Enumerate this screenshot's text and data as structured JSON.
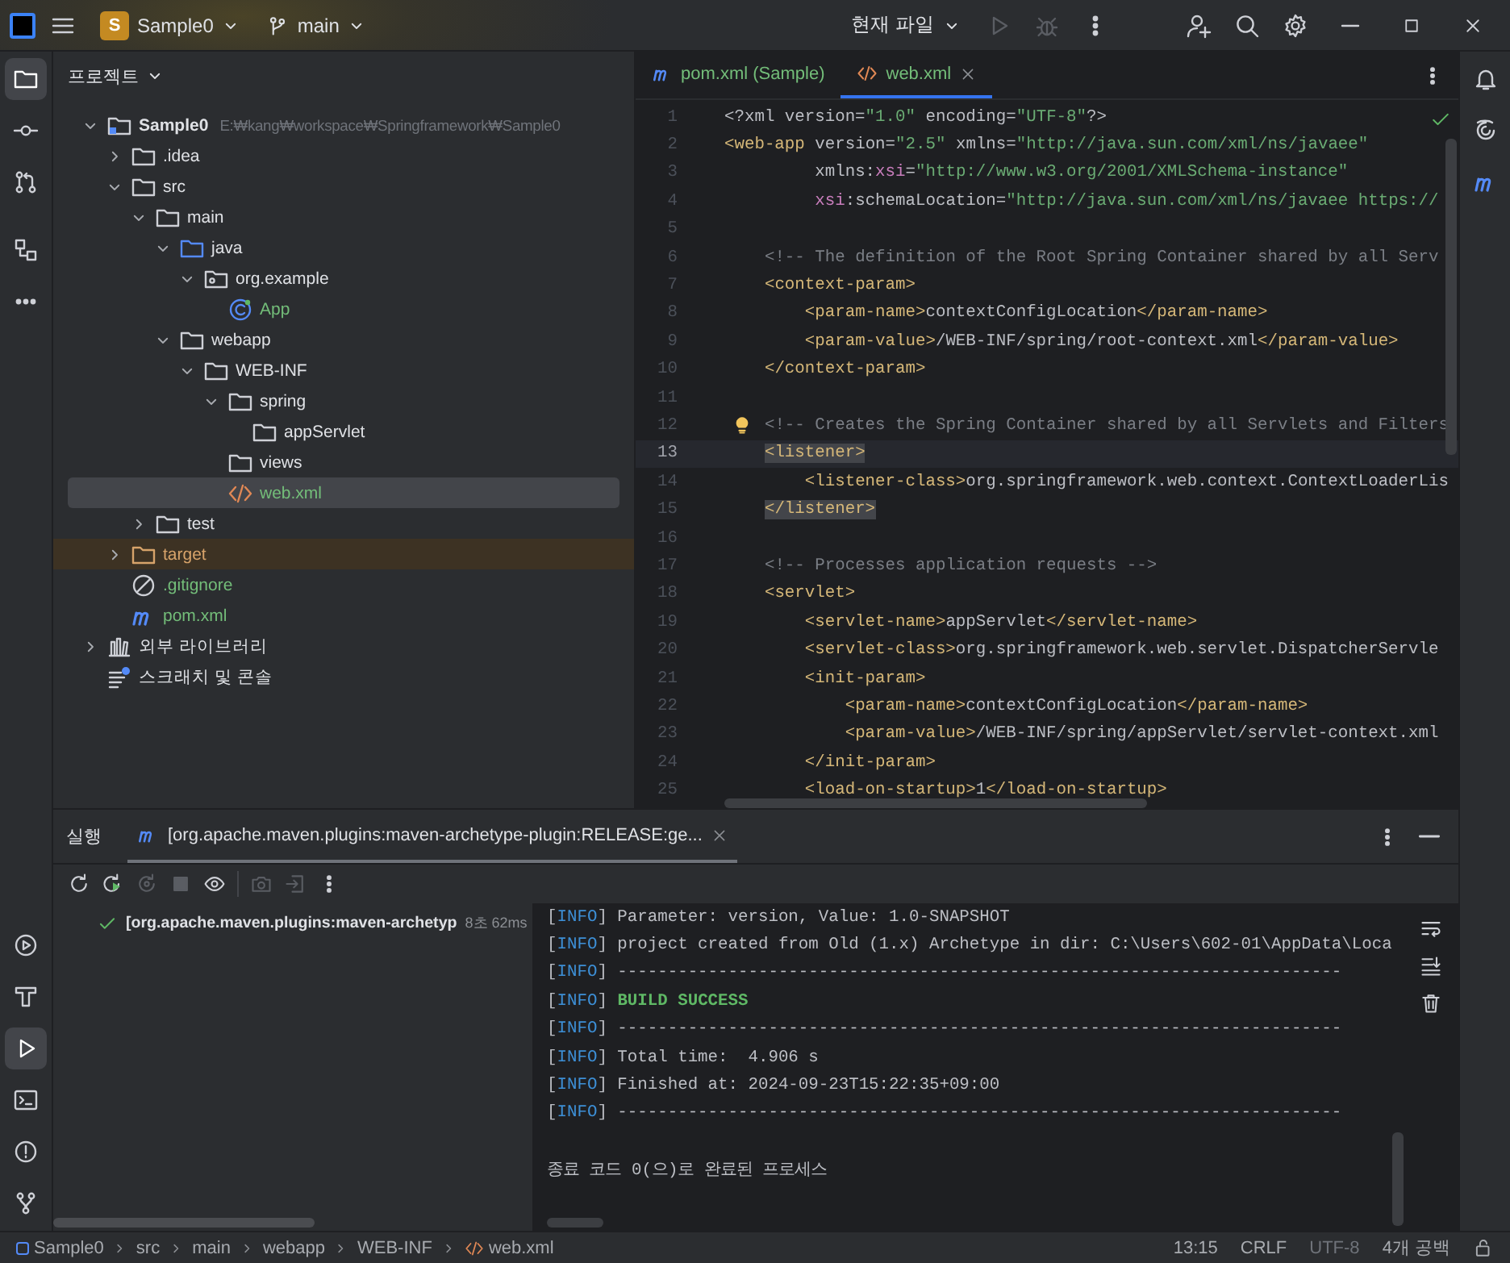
{
  "title_bar": {
    "project_badge": "S",
    "project": "Sample0",
    "branch": "main",
    "run_config": "현재 파일",
    "run_disabled": true,
    "debug_disabled": true
  },
  "left_toolbar": {
    "top": [
      {
        "kind": "folder",
        "selected": true
      },
      {
        "kind": "commit",
        "selected": false
      },
      {
        "kind": "pull",
        "selected": false
      },
      {
        "kind": "structure",
        "selected": false
      },
      {
        "kind": "more",
        "selected": false
      }
    ],
    "bottom": [
      {
        "kind": "services",
        "selected": false
      },
      {
        "kind": "build",
        "selected": false
      },
      {
        "kind": "run",
        "selected": true
      },
      {
        "kind": "terminal",
        "selected": false
      },
      {
        "kind": "problems",
        "selected": false
      },
      {
        "kind": "git",
        "selected": false
      }
    ]
  },
  "right_toolbar": [
    {
      "kind": "bell"
    },
    {
      "kind": "swirl"
    },
    {
      "kind": "maven"
    }
  ],
  "project_panel": {
    "title": "프로젝트",
    "tree": [
      {
        "label": "Sample0",
        "path": "E:₩kang₩workspace₩Springframework₩Sample0",
        "kind": "module",
        "expanded": true,
        "selected": false,
        "added": false,
        "children": [
          {
            "label": ".idea",
            "kind": "folder",
            "expanded": false,
            "selected": false,
            "added": false,
            "collapsed_children": true
          },
          {
            "label": "src",
            "kind": "folder",
            "expanded": true,
            "selected": false,
            "added": false,
            "children": [
              {
                "label": "main",
                "kind": "folder",
                "expanded": true,
                "selected": false,
                "added": false,
                "children": [
                  {
                    "label": "java",
                    "kind": "source",
                    "expanded": true,
                    "selected": false,
                    "added": false,
                    "children": [
                      {
                        "label": "org.example",
                        "kind": "package",
                        "expanded": true,
                        "selected": false,
                        "added": false,
                        "children": [
                          {
                            "label": "App",
                            "kind": "class",
                            "selected": false,
                            "added": true
                          }
                        ]
                      }
                    ]
                  },
                  {
                    "label": "webapp",
                    "kind": "folder",
                    "expanded": true,
                    "selected": false,
                    "added": false,
                    "children": [
                      {
                        "label": "WEB-INF",
                        "kind": "folder",
                        "expanded": true,
                        "selected": false,
                        "added": false,
                        "children": [
                          {
                            "label": "spring",
                            "kind": "folder",
                            "expanded": true,
                            "selected": false,
                            "added": false,
                            "children": [
                              {
                                "label": "appServlet",
                                "kind": "folder",
                                "selected": false,
                                "added": false
                              }
                            ]
                          },
                          {
                            "label": "views",
                            "kind": "folder",
                            "selected": false,
                            "added": false
                          },
                          {
                            "label": "web.xml",
                            "kind": "xml",
                            "selected": true,
                            "added": true
                          }
                        ]
                      }
                    ]
                  }
                ]
              },
              {
                "label": "test",
                "kind": "folder",
                "expanded": false,
                "selected": false,
                "added": false,
                "collapsed_children": true
              }
            ]
          },
          {
            "label": "target",
            "kind": "excluded",
            "expanded": false,
            "selected": false,
            "added": false,
            "collapsed_children": true
          },
          {
            "label": ".gitignore",
            "kind": "ignore",
            "selected": false,
            "added": true
          },
          {
            "label": "pom.xml",
            "kind": "maven",
            "selected": false,
            "added": true
          }
        ]
      },
      {
        "label": "외부 라이브러리",
        "kind": "library",
        "expanded": false,
        "selected": false,
        "added": false,
        "collapsed_children": true
      },
      {
        "label": "스크래치 및 콘솔",
        "kind": "scratch",
        "selected": false,
        "added": false
      }
    ]
  },
  "editor": {
    "tabs": [
      {
        "label": "pom.xml (Sample)",
        "kind": "maven",
        "selected": false
      },
      {
        "label": "web.xml",
        "kind": "xml",
        "selected": true
      }
    ],
    "inspection_ok": true,
    "lines": [
      {
        "number": "1",
        "current": false,
        "tokens": [
          {
            "kind": "plain",
            "text": "<?xml version="
          },
          {
            "kind": "value",
            "text": "\"1.0\""
          },
          {
            "kind": "plain",
            "text": " encoding="
          },
          {
            "kind": "value",
            "text": "\"UTF-8\""
          },
          {
            "kind": "plain",
            "text": "?>"
          }
        ]
      },
      {
        "number": "2",
        "current": false,
        "tokens": [
          {
            "kind": "tag",
            "text": "<web-app"
          },
          {
            "kind": "plain",
            "text": " version="
          },
          {
            "kind": "value",
            "text": "\"2.5\""
          },
          {
            "kind": "plain",
            "text": " xmlns="
          },
          {
            "kind": "value",
            "text": "\"http://java.sun.com/xml/ns/javaee\""
          }
        ]
      },
      {
        "number": "3",
        "current": false,
        "tokens": [
          {
            "kind": "plain",
            "text": "         xmlns:"
          },
          {
            "kind": "ns",
            "text": "xsi"
          },
          {
            "kind": "plain",
            "text": "="
          },
          {
            "kind": "value",
            "text": "\"http://www.w3.org/2001/XMLSchema-instance\""
          }
        ]
      },
      {
        "number": "4",
        "current": false,
        "tokens": [
          {
            "kind": "ns",
            "text": "         xsi"
          },
          {
            "kind": "plain",
            "text": ":schemaLocation="
          },
          {
            "kind": "value",
            "text": "\"http://java.sun.com/xml/ns/javaee https://"
          }
        ]
      },
      {
        "number": "5",
        "current": false
      },
      {
        "number": "6",
        "current": false,
        "tokens": [
          {
            "kind": "comment",
            "text": "    <!-- The definition of the Root Spring Container shared by all Serv"
          }
        ]
      },
      {
        "number": "7",
        "current": false,
        "tokens": [
          {
            "kind": "tag",
            "text": "    <context-param>"
          }
        ]
      },
      {
        "number": "8",
        "current": false,
        "tokens": [
          {
            "kind": "tag",
            "text": "        <param-name>"
          },
          {
            "kind": "plain",
            "text": "contextConfigLocation"
          },
          {
            "kind": "tag",
            "text": "</param-name>"
          }
        ]
      },
      {
        "number": "9",
        "current": false,
        "tokens": [
          {
            "kind": "tag",
            "text": "        <param-value>"
          },
          {
            "kind": "plain",
            "text": "/WEB-INF/spring/root-context.xml"
          },
          {
            "kind": "tag",
            "text": "</param-value>"
          }
        ]
      },
      {
        "number": "10",
        "current": false,
        "tokens": [
          {
            "kind": "tag",
            "text": "    </context-param>"
          }
        ]
      },
      {
        "number": "11",
        "current": false
      },
      {
        "number": "12",
        "current": false,
        "bulb": true,
        "tokens": [
          {
            "kind": "comment",
            "text": "    <!-- Creates the Spring Container shared by all Servlets and Filters"
          }
        ]
      },
      {
        "number": "13",
        "current": true,
        "tokens": [
          {
            "kind": "match",
            "text": "    <listener>"
          }
        ]
      },
      {
        "number": "14",
        "current": false,
        "tokens": [
          {
            "kind": "tag",
            "text": "        <listener-class>"
          },
          {
            "kind": "plain",
            "text": "org.springframework.web.context.ContextLoaderLis"
          }
        ]
      },
      {
        "number": "15",
        "current": false,
        "tokens": [
          {
            "kind": "match",
            "text": "    </listener>"
          }
        ]
      },
      {
        "number": "16",
        "current": false
      },
      {
        "number": "17",
        "current": false,
        "tokens": [
          {
            "kind": "comment",
            "text": "    <!-- Processes application requests -->"
          }
        ]
      },
      {
        "number": "18",
        "current": false,
        "tokens": [
          {
            "kind": "tag",
            "text": "    <servlet>"
          }
        ]
      },
      {
        "number": "19",
        "current": false,
        "tokens": [
          {
            "kind": "tag",
            "text": "        <servlet-name>"
          },
          {
            "kind": "plain",
            "text": "appServlet"
          },
          {
            "kind": "tag",
            "text": "</servlet-name>"
          }
        ]
      },
      {
        "number": "20",
        "current": false,
        "tokens": [
          {
            "kind": "tag",
            "text": "        <servlet-class>"
          },
          {
            "kind": "plain",
            "text": "org.springframework.web.servlet.DispatcherServle"
          }
        ]
      },
      {
        "number": "21",
        "current": false,
        "tokens": [
          {
            "kind": "tag",
            "text": "        <init-param>"
          }
        ]
      },
      {
        "number": "22",
        "current": false,
        "tokens": [
          {
            "kind": "tag",
            "text": "            <param-name>"
          },
          {
            "kind": "plain",
            "text": "contextConfigLocation"
          },
          {
            "kind": "tag",
            "text": "</param-name>"
          }
        ]
      },
      {
        "number": "23",
        "current": false,
        "tokens": [
          {
            "kind": "tag",
            "text": "            <param-value>"
          },
          {
            "kind": "plain",
            "text": "/WEB-INF/spring/appServlet/servlet-context.xml"
          }
        ]
      },
      {
        "number": "24",
        "current": false,
        "tokens": [
          {
            "kind": "tag",
            "text": "        </init-param>"
          }
        ]
      },
      {
        "number": "25",
        "current": false,
        "tokens": [
          {
            "kind": "tag",
            "text": "        <load-on-startup>"
          },
          {
            "kind": "plain",
            "text": "1"
          },
          {
            "kind": "tag",
            "text": "</load-on-startup>"
          }
        ]
      }
    ]
  },
  "run_panel": {
    "title": "실행",
    "tabs": [
      {
        "label": "[org.apache.maven.plugins:maven-archetype-plugin:RELEASE:ge...",
        "selected": true
      }
    ],
    "toolbar": [
      {
        "kind": "rerun",
        "disabled": false
      },
      {
        "kind": "rerun-failed",
        "disabled": false
      },
      {
        "kind": "rerun-alt",
        "disabled": true
      },
      {
        "kind": "stop",
        "disabled": true
      },
      {
        "kind": "eye",
        "disabled": false
      },
      {
        "kind": "camera",
        "disabled": true
      },
      {
        "kind": "exit",
        "disabled": true
      },
      {
        "kind": "more",
        "disabled": false
      }
    ],
    "tree": [
      {
        "label": "[org.apache.maven.plugins:maven-archetyp",
        "time": "8초 62ms",
        "succeeded": true
      }
    ],
    "console": [
      {
        "tokens": [
          {
            "kind": "plain",
            "text": "["
          },
          {
            "kind": "level",
            "text": "INFO"
          },
          {
            "kind": "plain",
            "text": "] Parameter: version, Value: 1.0-SNAPSHOT"
          }
        ]
      },
      {
        "tokens": [
          {
            "kind": "plain",
            "text": "["
          },
          {
            "kind": "level",
            "text": "INFO"
          },
          {
            "kind": "plain",
            "text": "] project created from Old (1.x) Archetype in dir: C:\\Users\\602-01\\AppData\\Loca"
          }
        ]
      },
      {
        "tokens": [
          {
            "kind": "plain",
            "text": "["
          },
          {
            "kind": "level",
            "text": "INFO"
          },
          {
            "kind": "plain",
            "text": "] ------------------------------------------------------------------------"
          }
        ]
      },
      {
        "tokens": [
          {
            "kind": "plain",
            "text": "["
          },
          {
            "kind": "level",
            "text": "INFO"
          },
          {
            "kind": "plain",
            "text": "] "
          },
          {
            "kind": "success",
            "text": "BUILD SUCCESS"
          }
        ]
      },
      {
        "tokens": [
          {
            "kind": "plain",
            "text": "["
          },
          {
            "kind": "level",
            "text": "INFO"
          },
          {
            "kind": "plain",
            "text": "] ------------------------------------------------------------------------"
          }
        ]
      },
      {
        "tokens": [
          {
            "kind": "plain",
            "text": "["
          },
          {
            "kind": "level",
            "text": "INFO"
          },
          {
            "kind": "plain",
            "text": "] Total time:  4.906 s"
          }
        ]
      },
      {
        "tokens": [
          {
            "kind": "plain",
            "text": "["
          },
          {
            "kind": "level",
            "text": "INFO"
          },
          {
            "kind": "plain",
            "text": "] Finished at: 2024-09-23T15:22:35+09:00"
          }
        ]
      },
      {
        "tokens": [
          {
            "kind": "plain",
            "text": "["
          },
          {
            "kind": "level",
            "text": "INFO"
          },
          {
            "kind": "plain",
            "text": "] ------------------------------------------------------------------------"
          }
        ]
      },
      {
        "spaced": true,
        "tokens": [
          {
            "kind": "plain",
            "text": "종료 코드 0(으)로 완료된 프로세스"
          }
        ]
      }
    ],
    "side_actions": [
      {
        "kind": "wrap"
      },
      {
        "kind": "scroll-end"
      },
      {
        "kind": "trash"
      }
    ]
  },
  "status_bar": {
    "breadcrumbs": [
      {
        "label": "Sample0",
        "kind": "module"
      },
      {
        "label": "src",
        "kind": "none"
      },
      {
        "label": "main",
        "kind": "none"
      },
      {
        "label": "webapp",
        "kind": "none"
      },
      {
        "label": "WEB-INF",
        "kind": "none"
      },
      {
        "label": "web.xml",
        "kind": "xml"
      }
    ],
    "items": [
      {
        "label": "13:15",
        "disabled": false
      },
      {
        "label": "CRLF",
        "disabled": false
      },
      {
        "label": "UTF-8",
        "disabled": true
      },
      {
        "label": "4개 공백",
        "disabled": false
      }
    ]
  }
}
